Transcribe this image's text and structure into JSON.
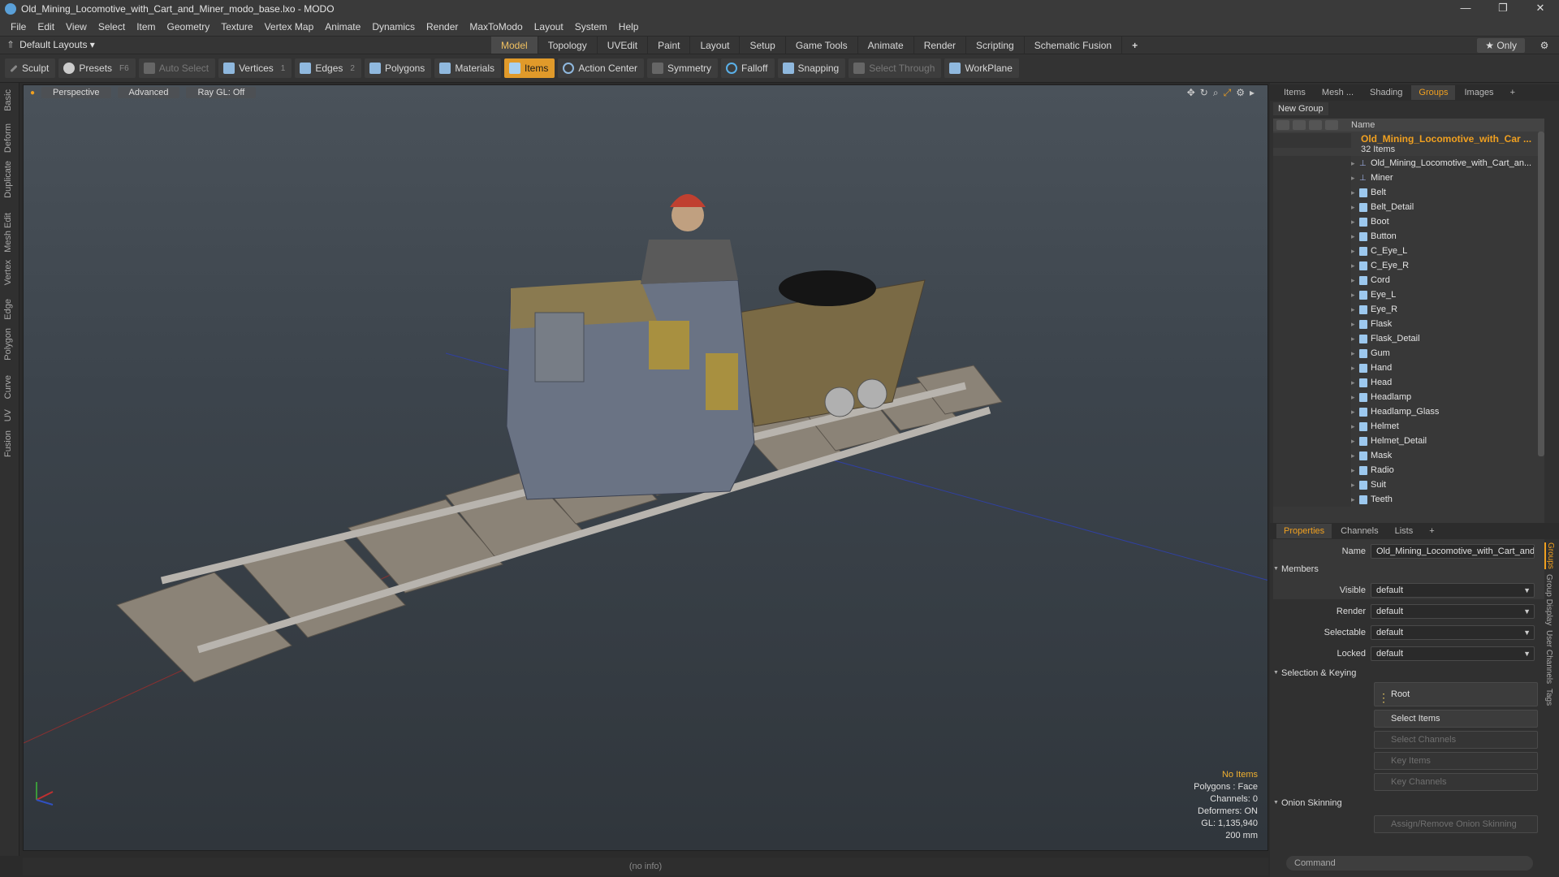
{
  "window": {
    "title": "Old_Mining_Locomotive_with_Cart_and_Miner_modo_base.lxo - MODO",
    "controls": [
      "—",
      "❐",
      "✕"
    ]
  },
  "menu": [
    "File",
    "Edit",
    "View",
    "Select",
    "Item",
    "Geometry",
    "Texture",
    "Vertex Map",
    "Animate",
    "Dynamics",
    "Render",
    "MaxToModo",
    "Layout",
    "System",
    "Help"
  ],
  "layoutbar": {
    "layouts_label": "Default Layouts ▾",
    "tabs": [
      "Model",
      "Topology",
      "UVEdit",
      "Paint",
      "Layout",
      "Setup",
      "Game Tools",
      "Animate",
      "Render",
      "Scripting",
      "Schematic Fusion",
      "+"
    ],
    "active_tab": "Model",
    "only_label": "★  Only"
  },
  "toolbar": {
    "sculpt": "Sculpt",
    "presets": "Presets",
    "presets_key": "F6",
    "auto_select": "Auto Select",
    "vertices": "Vertices",
    "vertices_key": "1",
    "edges": "Edges",
    "edges_key": "2",
    "polygons": "Polygons",
    "materials": "Materials",
    "items": "Items",
    "action_center": "Action Center",
    "symmetry": "Symmetry",
    "falloff": "Falloff",
    "snapping": "Snapping",
    "select_through": "Select Through",
    "workplane": "WorkPlane"
  },
  "left_tabs": [
    "Basic",
    "Deform",
    "Duplicate",
    "Mesh Edit",
    "Vertex",
    "Edge",
    "Polygon",
    "Curve",
    "UV",
    "Fusion"
  ],
  "viewport": {
    "view": "Perspective",
    "shading": "Advanced",
    "raygl": "Ray GL: Off",
    "info": {
      "no_items": "No Items",
      "polygons": "Polygons : Face",
      "channels": "Channels: 0",
      "deformers": "Deformers: ON",
      "gl": "GL: 1,135,940",
      "scale": "200 mm"
    }
  },
  "status": "(no info)",
  "right_panel": {
    "tabs": [
      "Items",
      "Mesh ...",
      "Shading",
      "Groups",
      "Images",
      "+"
    ],
    "active_tab": "Groups",
    "new_group": "New Group",
    "name_col": "Name",
    "group_name": "Old_Mining_Locomotive_with_Car ...",
    "group_count": "32 Items",
    "items": [
      "Old_Mining_Locomotive_with_Cart_an...",
      "Miner",
      "Belt",
      "Belt_Detail",
      "Boot",
      "Button",
      "C_Eye_L",
      "C_Eye_R",
      "Cord",
      "Eye_L",
      "Eye_R",
      "Flask",
      "Flask_Detail",
      "Gum",
      "Hand",
      "Head",
      "Headlamp",
      "Headlamp_Glass",
      "Helmet",
      "Helmet_Detail",
      "Mask",
      "Radio",
      "Suit",
      "Teeth"
    ]
  },
  "properties": {
    "tabs": [
      "Properties",
      "Channels",
      "Lists",
      "+"
    ],
    "name_label": "Name",
    "name_value": "Old_Mining_Locomotive_with_Cart_and",
    "members": "Members",
    "visible_label": "Visible",
    "render_label": "Render",
    "selectable_label": "Selectable",
    "locked_label": "Locked",
    "default_value": "default",
    "selection_keying": "Selection & Keying",
    "root": "Root",
    "select_items": "Select Items",
    "select_channels": "Select Channels",
    "key_items": "Key Items",
    "key_channels": "Key Channels",
    "onion": "Onion Skinning",
    "onion_btn": "Assign/Remove Onion Skinning",
    "side_tabs": [
      "Groups",
      "Group Display",
      "User Channels",
      "Tags"
    ],
    "command_placeholder": "Command"
  }
}
